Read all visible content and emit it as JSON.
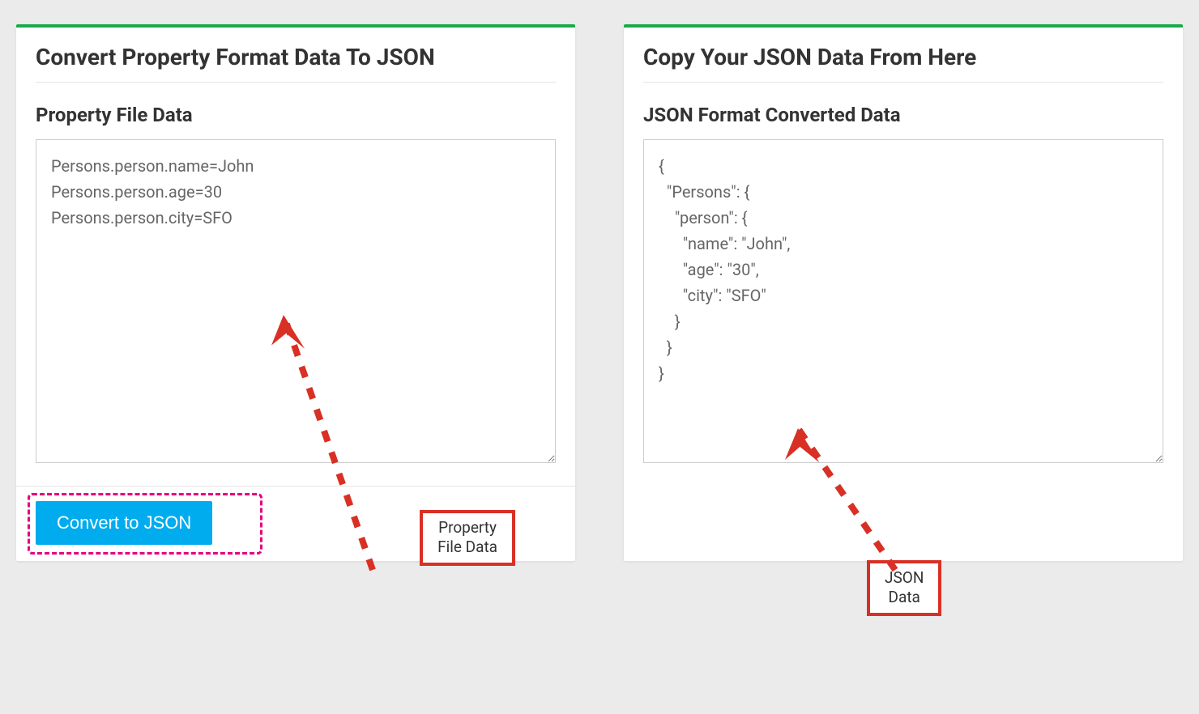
{
  "left_panel": {
    "title": "Convert Property Format Data To JSON",
    "section_label": "Property File Data",
    "textarea_value": "Persons.person.name=John\nPersons.person.age=30\nPersons.person.city=SFO",
    "convert_button_label": "Convert to JSON",
    "annotation_label": "Property\nFile Data"
  },
  "right_panel": {
    "title": "Copy Your JSON Data From Here",
    "section_label": "JSON Format Converted Data",
    "textarea_value": "{\n  \"Persons\": {\n    \"person\": {\n      \"name\": \"John\",\n      \"age\": \"30\",\n      \"city\": \"SFO\"\n    }\n  }\n}",
    "annotation_label": "JSON\nData"
  },
  "colors": {
    "accent_green": "#1ba94c",
    "button_blue": "#00acee",
    "highlight_pink": "#e6007e",
    "annotation_red": "#d93025"
  }
}
